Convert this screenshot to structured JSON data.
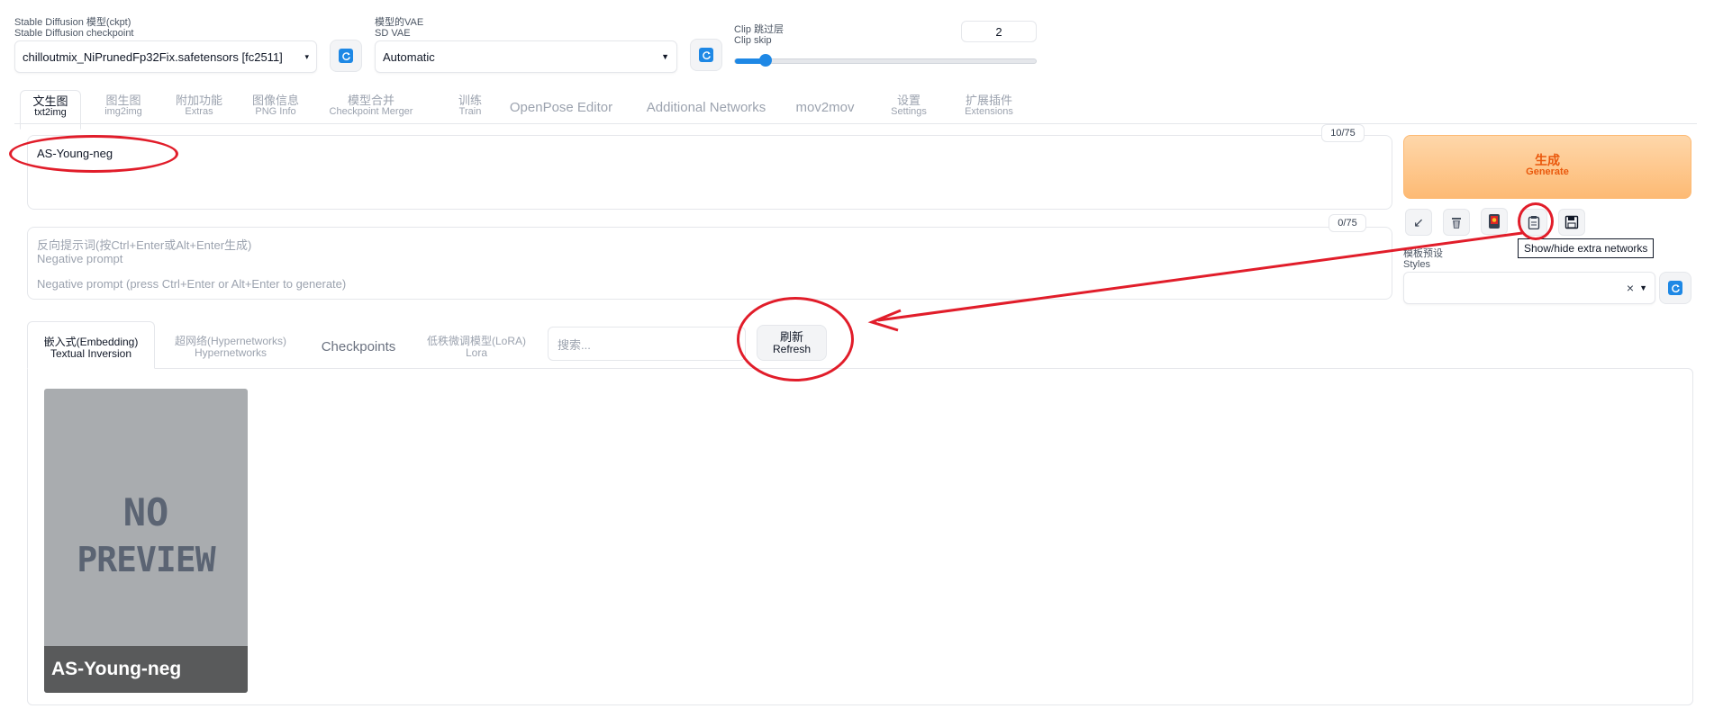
{
  "top": {
    "ckpt_label_cn": "Stable Diffusion 模型(ckpt)",
    "ckpt_label_en": "Stable Diffusion checkpoint",
    "ckpt_value": "chilloutmix_NiPrunedFp32Fix.safetensors [fc2511]",
    "vae_label_cn": "模型的VAE",
    "vae_label_en": "SD VAE",
    "vae_value": "Automatic",
    "clip_label_cn": "Clip 跳过层",
    "clip_label_en": "Clip skip",
    "clip_value": "2",
    "clip_slider_fraction": 0.1
  },
  "tabs": [
    {
      "cn": "文生图",
      "en": "txt2img"
    },
    {
      "cn": "图生图",
      "en": "img2img"
    },
    {
      "cn": "附加功能",
      "en": "Extras"
    },
    {
      "cn": "图像信息",
      "en": "PNG Info"
    },
    {
      "cn": "模型合并",
      "en": "Checkpoint Merger"
    },
    {
      "cn": "训练",
      "en": "Train"
    },
    {
      "single": "OpenPose Editor"
    },
    {
      "single": "Additional Networks"
    },
    {
      "single": "mov2mov"
    },
    {
      "cn": "设置",
      "en": "Settings"
    },
    {
      "cn": "扩展插件",
      "en": "Extensions"
    }
  ],
  "prompt": {
    "value": "AS-Young-neg",
    "counter": "10/75"
  },
  "negative": {
    "label_cn": "反向提示词(按Ctrl+Enter或Alt+Enter生成)",
    "label_en": "Negative prompt",
    "placeholder": "Negative prompt (press Ctrl+Enter or Alt+Enter to generate)",
    "counter": "0/75"
  },
  "generate": {
    "label_cn": "生成",
    "label_en": "Generate"
  },
  "tools": {
    "tooltip": "Show/hide extra networks",
    "styles_label_cn": "模板预设",
    "styles_label_en": "Styles",
    "styles_clear": "×"
  },
  "extra_tabs": [
    {
      "cn": "嵌入式(Embedding)",
      "en": "Textual Inversion"
    },
    {
      "cn": "超网络(Hypernetworks)",
      "en": "Hypernetworks"
    },
    {
      "single": "Checkpoints"
    },
    {
      "cn": "低秩微调模型(LoRA)",
      "en": "Lora"
    }
  ],
  "search": {
    "placeholder": "搜索..."
  },
  "refresh": {
    "label_cn": "刷新",
    "label_en": "Refresh"
  },
  "card": {
    "preview_text_1": "NO",
    "preview_text_2": "PREVIEW",
    "name": "AS-Young-neg"
  },
  "colors": {
    "accent_blue": "#1e88e5",
    "annotation_red": "#e11d2a",
    "generate_orange": "#ea580c"
  }
}
